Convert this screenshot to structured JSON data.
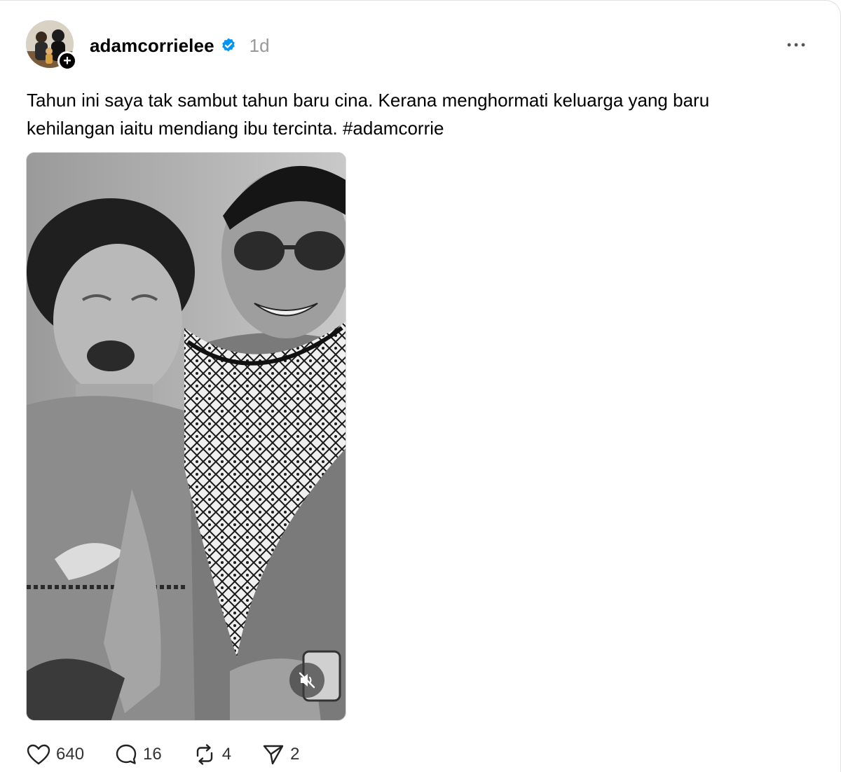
{
  "post": {
    "username": "adamcorrielee",
    "time": "1d",
    "text": "Tahun ini saya tak sambut tahun baru cina. Kerana menghormati keluarga yang baru kehilangan iaitu mendiang ibu tercinta. #adamcorrie",
    "follow_symbol": "+"
  },
  "actions": {
    "likes": "640",
    "replies": "16",
    "reposts": "4",
    "shares": "2"
  },
  "icons": {
    "verified": "verified-badge-icon",
    "more": "more-options-icon",
    "like": "heart-icon",
    "reply": "comment-icon",
    "repost": "repost-icon",
    "share": "send-icon",
    "mute": "muted-speaker-icon"
  },
  "colors": {
    "verified_blue": "#0095f6",
    "muted_text": "#999999",
    "text": "#000000"
  }
}
